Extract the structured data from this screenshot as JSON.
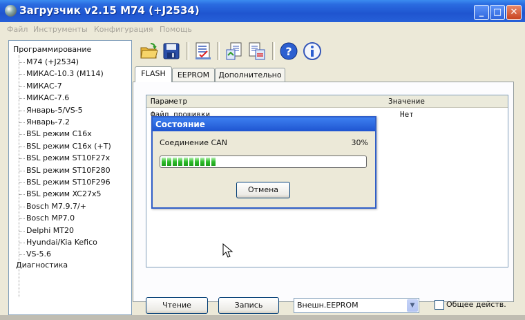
{
  "window": {
    "title": "Загрузчик v2.15 M74 (+J2534)",
    "controls": {
      "minimize": "_",
      "maximize": "□",
      "close": "✕"
    }
  },
  "menu": {
    "items": [
      "Файл",
      "Инструменты",
      "Конфигурация",
      "Помощь"
    ]
  },
  "tree": {
    "root": "Программирование",
    "items": [
      "M74 (+J2534)",
      "МИКАС-10.3 (M114)",
      "МИКАС-7",
      "МИКАС-7.6",
      "Январь-5/VS-5",
      "Январь-7.2",
      "BSL режим C16x",
      "BSL режим C16x (+T)",
      "BSL режим ST10F27x",
      "BSL режим ST10F280",
      "BSL режим ST10F296",
      "BSL режим XC27x5",
      "Bosch M7.9.7/+",
      "Bosch MP7.0",
      "Delphi MT20",
      "Hyundai/Kia Kefico",
      "VS-5.6"
    ],
    "diagnostics": "Диагностика"
  },
  "toolbar": {
    "icons": [
      "open-folder-icon",
      "save-disk-icon",
      "checklist-icon",
      "export-icon",
      "import-icon",
      "help-icon",
      "info-icon"
    ]
  },
  "tabs": {
    "items": [
      "FLASH",
      "EEPROM",
      "Дополнительно"
    ],
    "active": "FLASH"
  },
  "list": {
    "headers": [
      "Параметр",
      "Значение"
    ],
    "rows": [
      {
        "param": "Файл прошивки",
        "value": "Нет"
      }
    ]
  },
  "bottom": {
    "read_label": "Чтение",
    "write_label": "Запись",
    "combo_value": "Внешн.EEPROM",
    "check_label": "Общее действ."
  },
  "dialog": {
    "title": "Состояние",
    "label": "Соединение CAN",
    "percent_text": "30%",
    "progress": 0.3,
    "cancel_label": "Отмена"
  },
  "colors": {
    "titlebar": "#2a6be0",
    "progress": "#2cbc2a",
    "face": "#ece9d8"
  }
}
